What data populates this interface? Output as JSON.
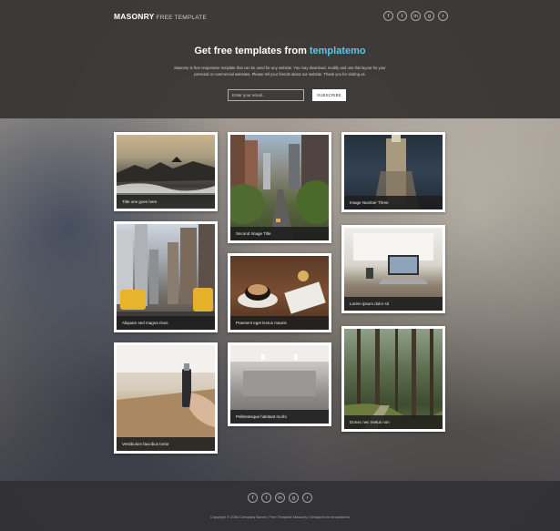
{
  "brand": {
    "bold": "MASONRY",
    "light": "FREE TEMPLATE"
  },
  "social_icons": [
    {
      "name": "facebook-icon",
      "glyph": "f"
    },
    {
      "name": "twitter-icon",
      "glyph": "t"
    },
    {
      "name": "linkedin-icon",
      "glyph": "in"
    },
    {
      "name": "google-plus-icon",
      "glyph": "g"
    },
    {
      "name": "rss-icon",
      "glyph": "r"
    }
  ],
  "hero": {
    "title_prefix": "Get free templates from",
    "title_accent": "templatemo",
    "text": "Masonry is free responsive template that can be used for any website. You may download, modify and use this layout for your personal or commercial websites. Please tell your friends about our website. Thank you for visiting us.",
    "email_placeholder": "Enter your email...",
    "subscribe_label": "SUBSCRIBE"
  },
  "gallery": [
    {
      "caption": "Title one goes here"
    },
    {
      "caption": "Second Image Title"
    },
    {
      "caption": "Image Number Three"
    },
    {
      "caption": "Aliquam sed magna risus"
    },
    {
      "caption": "Praesent eget lectus mauris"
    },
    {
      "caption": "Lorem ipsum dolor sit"
    },
    {
      "caption": "Vestibulum faucibus tortor"
    },
    {
      "caption": "Pellentesque habitant morbi"
    },
    {
      "caption": "Donec nec metus non"
    }
  ],
  "footer": {
    "copyright": "Copyright © 2084 Company Name | Free Template Masonry | Design from templatemo"
  },
  "colors": {
    "accent": "#5ec6e8",
    "header_bg": "#3a3836",
    "footer_bg": "#323234"
  }
}
